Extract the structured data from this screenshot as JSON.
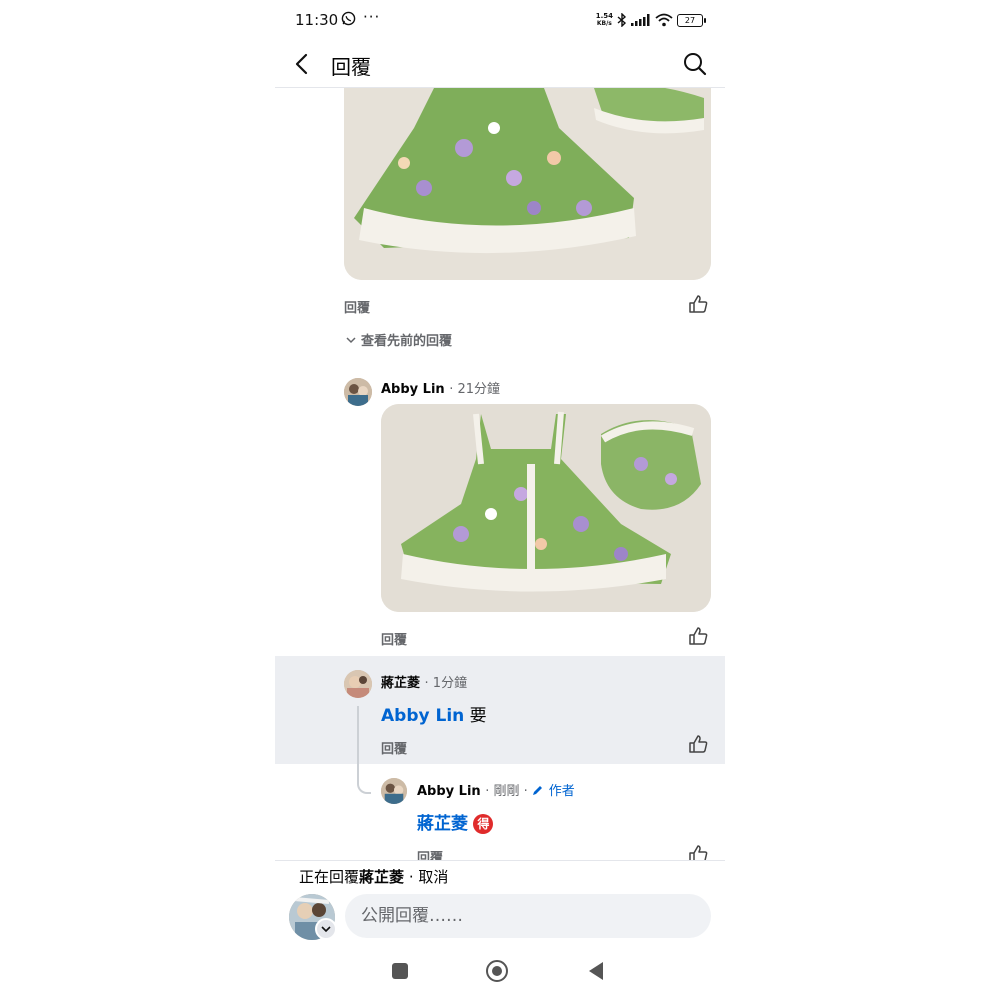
{
  "status_bar": {
    "time": "11:30",
    "more_dots": "···",
    "network_speed_value": "1.54",
    "network_speed_unit": "KB/s",
    "battery": "27"
  },
  "header": {
    "title": "回覆"
  },
  "comments": [
    {
      "reply_label": "回覆"
    },
    {
      "author": "Abby Lin",
      "time": "· 21分鐘",
      "reply_label": "回覆"
    },
    {
      "author": "蔣芷菱",
      "time": "· 1分鐘",
      "mention": "Abby Lin",
      "text": " 要",
      "reply_label": "回覆"
    },
    {
      "author": "Abby Lin",
      "time": "· 剛剛 ·",
      "author_badge": "作者",
      "mention": "蔣芷菱",
      "emoji": "得",
      "reply_label": "回覆"
    }
  ],
  "view_previous": "查看先前的回覆",
  "composer": {
    "replying_prefix": "正在回覆",
    "replying_name": "蔣芷菱",
    "separator": "·",
    "cancel": "取消",
    "placeholder": "公開回覆……"
  },
  "colors": {
    "mention_blue": "#0064d1",
    "meta_gray": "#65676b",
    "highlight_bg": "#eceef2"
  }
}
